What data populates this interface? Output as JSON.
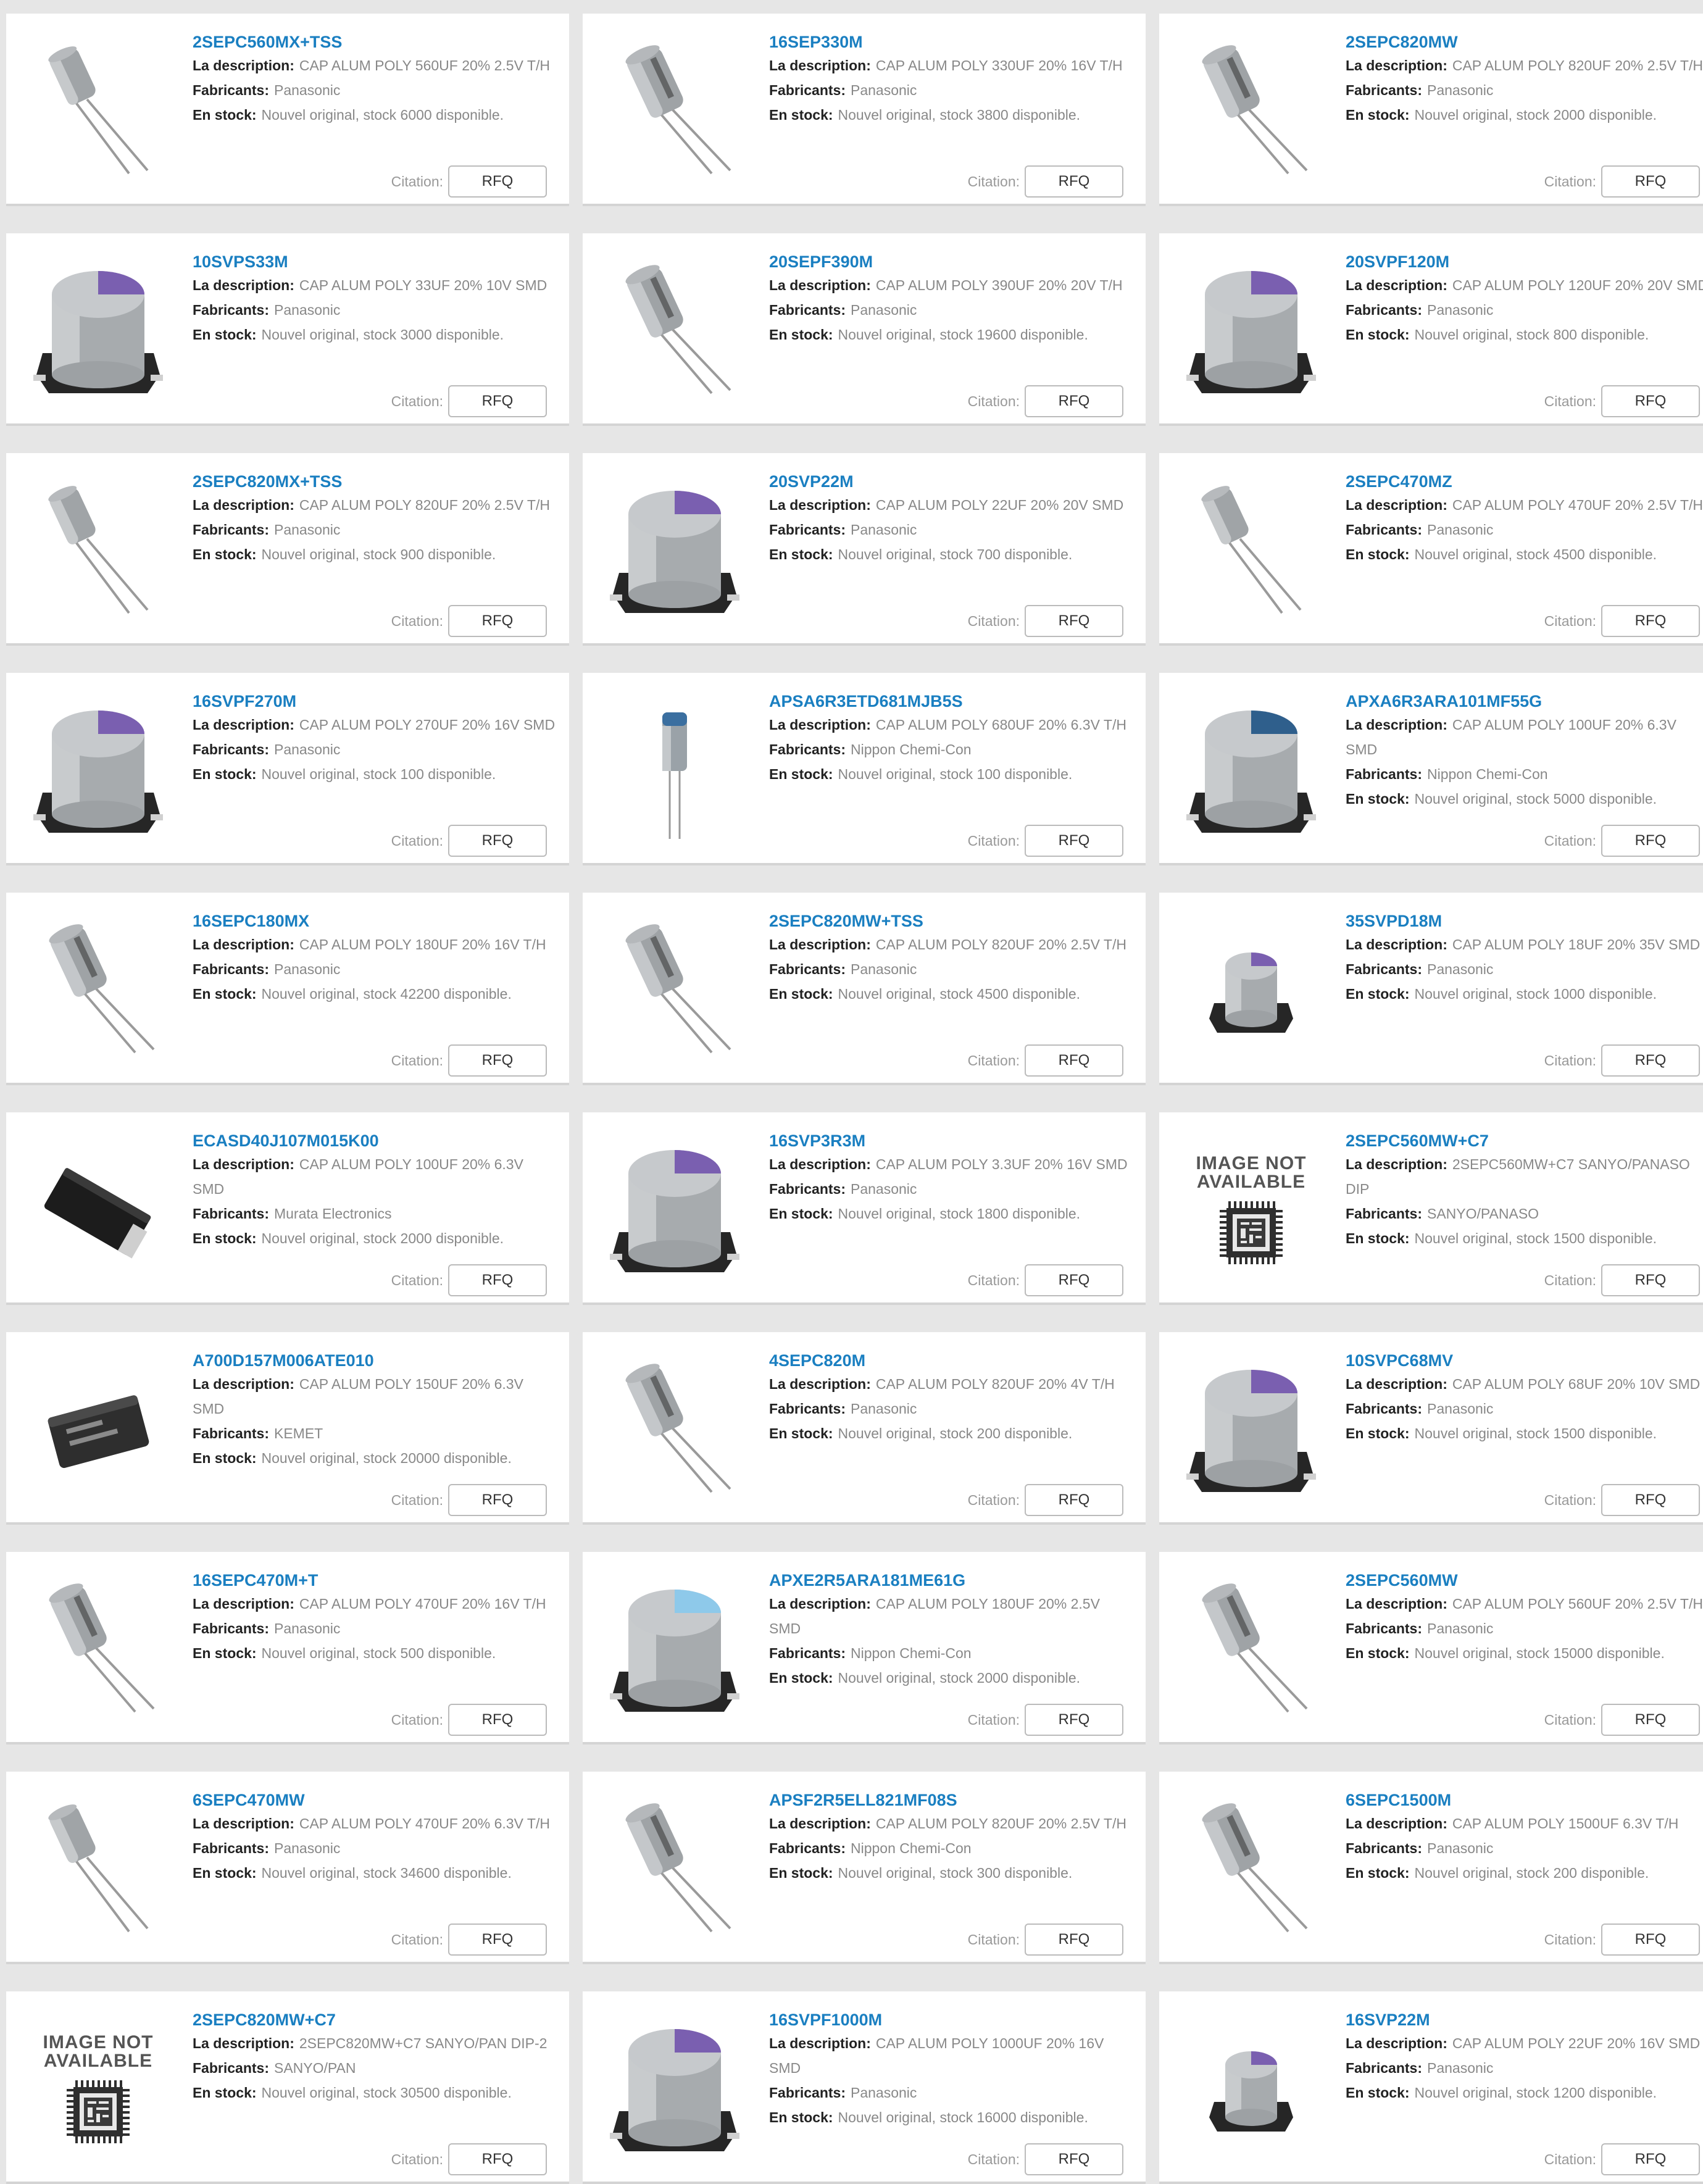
{
  "labels": {
    "description": "La description:",
    "manufacturer": "Fabricants:",
    "stock": "En stock:",
    "quote": "Citation:",
    "rfq": "RFQ",
    "image_not_available": "IMAGE NOT AVAILABLE"
  },
  "colors": {
    "page_bg": "#e6e6e6",
    "card_bg": "#ffffff",
    "link": "#1a7fc1",
    "label": "#222222",
    "value": "#888888"
  },
  "products": [
    {
      "pn": "2SEPC560MX+TSS",
      "desc": "CAP ALUM POLY 560UF 20% 2.5V T/H",
      "mfr": "Panasonic",
      "stock": "Nouvel original, stock 6000 disponible.",
      "img": "radial-small",
      "wrap": true
    },
    {
      "pn": "16SEP330M",
      "desc": "CAP ALUM POLY 330UF 20% 16V T/H",
      "mfr": "Panasonic",
      "stock": "Nouvel original, stock 3800 disponible.",
      "img": "radial",
      "wrap": false
    },
    {
      "pn": "2SEPC820MW",
      "desc": "CAP ALUM POLY 820UF 20% 2.5V T/H",
      "mfr": "Panasonic",
      "stock": "Nouvel original, stock 2000 disponible.",
      "img": "radial",
      "wrap": true
    },
    {
      "pn": "10SVPS33M",
      "desc": "CAP ALUM POLY 33UF 20% 10V SMD",
      "mfr": "Panasonic",
      "stock": "Nouvel original, stock 3000 disponible.",
      "img": "smd-purple",
      "wrap": false
    },
    {
      "pn": "20SEPF390M",
      "desc": "CAP ALUM POLY 390UF 20% 20V T/H",
      "mfr": "Panasonic",
      "stock": "Nouvel original, stock 19600 disponible.",
      "img": "radial",
      "wrap": false
    },
    {
      "pn": "20SVPF120M",
      "desc": "CAP ALUM POLY 120UF 20% 20V SMD",
      "mfr": "Panasonic",
      "stock": "Nouvel original, stock 800 disponible.",
      "img": "smd-purple",
      "wrap": true
    },
    {
      "pn": "2SEPC820MX+TSS",
      "desc": "CAP ALUM POLY 820UF 20% 2.5V T/H",
      "mfr": "Panasonic",
      "stock": "Nouvel original, stock 900 disponible.",
      "img": "radial-small",
      "wrap": true
    },
    {
      "pn": "20SVP22M",
      "desc": "CAP ALUM POLY 22UF 20% 20V SMD",
      "mfr": "Panasonic",
      "stock": "Nouvel original, stock 700 disponible.",
      "img": "smd-purple",
      "wrap": false
    },
    {
      "pn": "2SEPC470MZ",
      "desc": "CAP ALUM POLY 470UF 20% 2.5V T/H",
      "mfr": "Panasonic",
      "stock": "Nouvel original, stock 4500 disponible.",
      "img": "radial-small",
      "wrap": true
    },
    {
      "pn": "16SVPF270M",
      "desc": "CAP ALUM POLY 270UF 20% 16V SMD",
      "mfr": "Panasonic",
      "stock": "Nouvel original, stock 100 disponible.",
      "img": "smd-purple",
      "wrap": true
    },
    {
      "pn": "APSA6R3ETD681MJB5S",
      "desc": "CAP ALUM POLY 680UF 20% 6.3V T/H",
      "mfr": "Nippon Chemi-Con",
      "stock": "Nouvel original, stock 100 disponible.",
      "img": "radial-blue",
      "wrap": true
    },
    {
      "pn": "APXA6R3ARA101MF55G",
      "desc": "CAP ALUM POLY 100UF 20% 6.3V SMD",
      "mfr": "Nippon Chemi-Con",
      "stock": "Nouvel original, stock 5000 disponible.",
      "img": "smd-blue",
      "wrap": true
    },
    {
      "pn": "16SEPC180MX",
      "desc": "CAP ALUM POLY 180UF 20% 16V T/H",
      "mfr": "Panasonic",
      "stock": "Nouvel original, stock 42200 disponible.",
      "img": "radial",
      "wrap": false
    },
    {
      "pn": "2SEPC820MW+TSS",
      "desc": "CAP ALUM POLY 820UF 20% 2.5V T/H",
      "mfr": "Panasonic",
      "stock": "Nouvel original, stock 4500 disponible.",
      "img": "radial",
      "wrap": true
    },
    {
      "pn": "35SVPD18M",
      "desc": "CAP ALUM POLY 18UF 20% 35V SMD",
      "mfr": "Panasonic",
      "stock": "Nouvel original, stock 1000 disponible.",
      "img": "smd-small",
      "wrap": false
    },
    {
      "pn": "ECASD40J107M015K00",
      "desc": "CAP ALUM POLY 100UF 20% 6.3V SMD",
      "mfr": "Murata Electronics",
      "stock": "Nouvel original, stock 2000 disponible.",
      "img": "chip-black",
      "wrap": true
    },
    {
      "pn": "16SVP3R3M",
      "desc": "CAP ALUM POLY 3.3UF 20% 16V SMD",
      "mfr": "Panasonic",
      "stock": "Nouvel original, stock 1800 disponible.",
      "img": "smd-purple",
      "wrap": true
    },
    {
      "pn": "2SEPC560MW+C7",
      "desc": "2SEPC560MW+C7 SANYO/PANASO DIP",
      "mfr": "SANYO/PANASO",
      "stock": "Nouvel original, stock 1500 disponible.",
      "img": "na",
      "wrap": true
    },
    {
      "pn": "A700D157M006ATE010",
      "desc": "CAP ALUM POLY 150UF 20% 6.3V SMD",
      "mfr": "KEMET",
      "stock": "Nouvel original, stock 20000 disponible.",
      "img": "chip-dark",
      "wrap": true
    },
    {
      "pn": "4SEPC820M",
      "desc": "CAP ALUM POLY 820UF 20% 4V T/H",
      "mfr": "Panasonic",
      "stock": "Nouvel original, stock 200 disponible.",
      "img": "radial",
      "wrap": false
    },
    {
      "pn": "10SVPC68MV",
      "desc": "CAP ALUM POLY 68UF 20% 10V SMD",
      "mfr": "Panasonic",
      "stock": "Nouvel original, stock 1500 disponible.",
      "img": "smd-purple",
      "wrap": false
    },
    {
      "pn": "16SEPC470M+T",
      "desc": "CAP ALUM POLY 470UF 20% 16V T/H",
      "mfr": "Panasonic",
      "stock": "Nouvel original, stock 500 disponible.",
      "img": "radial",
      "wrap": false
    },
    {
      "pn": "APXE2R5ARA181ME61G",
      "desc": "CAP ALUM POLY 180UF 20% 2.5V SMD",
      "mfr": "Nippon Chemi-Con",
      "stock": "Nouvel original, stock 2000 disponible.",
      "img": "smd-lightblue",
      "wrap": true
    },
    {
      "pn": "2SEPC560MW",
      "desc": "CAP ALUM POLY 560UF 20% 2.5V T/H",
      "mfr": "Panasonic",
      "stock": "Nouvel original, stock 15000 disponible.",
      "img": "radial",
      "wrap": true
    },
    {
      "pn": "6SEPC470MW",
      "desc": "CAP ALUM POLY 470UF 20% 6.3V T/H",
      "mfr": "Panasonic",
      "stock": "Nouvel original, stock 34600 disponible.",
      "img": "radial-small",
      "wrap": true
    },
    {
      "pn": "APSF2R5ELL821MF08S",
      "desc": "CAP ALUM POLY 820UF 20% 2.5V T/H",
      "mfr": "Nippon Chemi-Con",
      "stock": "Nouvel original, stock 300 disponible.",
      "img": "radial",
      "wrap": true
    },
    {
      "pn": "6SEPC1500M",
      "desc": "CAP ALUM POLY 1500UF 6.3V T/H",
      "mfr": "Panasonic",
      "stock": "Nouvel original, stock 200 disponible.",
      "img": "radial",
      "wrap": false
    },
    {
      "pn": "2SEPC820MW+C7",
      "desc": "2SEPC820MW+C7 SANYO/PAN DIP-2",
      "mfr": "SANYO/PAN",
      "stock": "Nouvel original, stock 30500 disponible.",
      "img": "na",
      "wrap": false
    },
    {
      "pn": "16SVPF1000M",
      "desc": "CAP ALUM POLY 1000UF 20% 16V SMD",
      "mfr": "Panasonic",
      "stock": "Nouvel original, stock 16000 disponible.",
      "img": "smd-purple",
      "wrap": true
    },
    {
      "pn": "16SVP22M",
      "desc": "CAP ALUM POLY 22UF 20% 16V SMD",
      "mfr": "Panasonic",
      "stock": "Nouvel original, stock 1200 disponible.",
      "img": "smd-small",
      "wrap": false
    }
  ]
}
